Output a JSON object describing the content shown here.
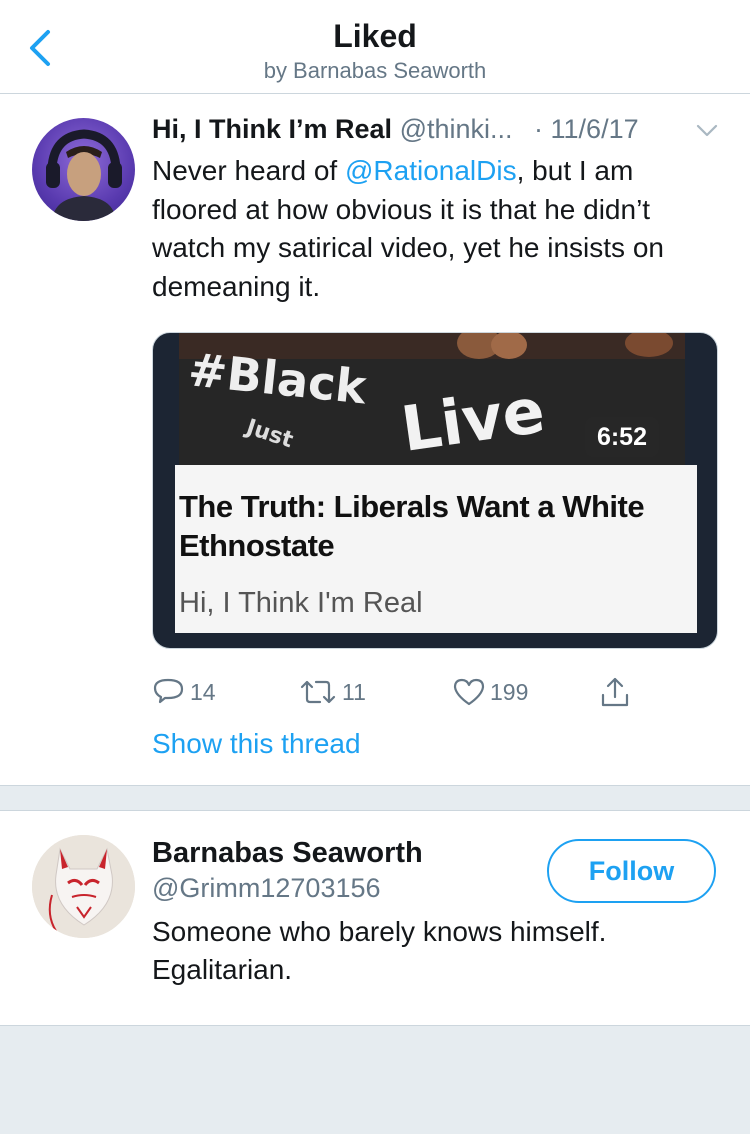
{
  "header": {
    "title": "Liked",
    "subtitle": "by Barnabas Seaworth",
    "back_icon": "chevron-left-icon"
  },
  "tweet": {
    "author_name": "Hi, I Think I’m Real",
    "author_handle": "@thinki...",
    "date": "· 11/6/17",
    "text_before": "Never heard of ",
    "mention": "@RationalDis",
    "text_after": ", but I am floored at how obvious it is that he didn’t watch my satirical video, yet he insists on demeaning it.",
    "card": {
      "thumbnail_text_1": "#Black",
      "thumbnail_text_2": "Live",
      "thumbnail_text_3": "Just",
      "duration": "6:52",
      "title": "The Truth: Liberals Want a White Ethnostate",
      "site": "Hi, I Think I'm Real"
    },
    "actions": {
      "replies": "14",
      "retweets": "11",
      "likes": "199"
    },
    "show_thread": "Show this thread"
  },
  "profile": {
    "name": "Barnabas Seaworth",
    "handle": "@Grimm12703156",
    "bio": "Someone who barely knows himself. Egalitarian.",
    "follow_label": "Follow"
  },
  "colors": {
    "accent": "#1da1f2",
    "secondary_text": "#657786",
    "background": "#e6ecf0"
  }
}
